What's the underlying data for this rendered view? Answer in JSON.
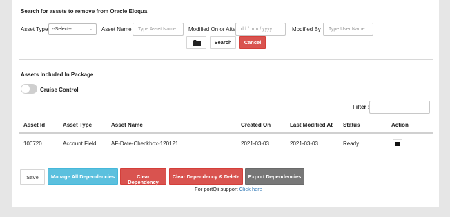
{
  "search": {
    "title": "Search for assets to remove from Oracle Eloqua",
    "asset_type_label": "Asset Type",
    "asset_type_value": "--Select--",
    "asset_name_label": "Asset Name",
    "asset_name_placeholder": "Type Asset Name",
    "modified_label": "Modified On or After",
    "modified_placeholder": "dd / mm / yyyy",
    "modified_by_label": "Modified By",
    "modified_by_placeholder": "Type User Name",
    "search_button": "Search",
    "cancel_button": "Cancel"
  },
  "package": {
    "title": "Assets Included In Package",
    "cruise_control_label": "Cruise Control",
    "cruise_control_on": false,
    "filter_label": "Filter :"
  },
  "table": {
    "columns": [
      "Asset Id",
      "Asset Type",
      "Asset Name",
      "Created On",
      "Last Modified At",
      "Status",
      "Action"
    ],
    "rows": [
      [
        "100720",
        "Account Field",
        "AF-Date-Checkbox-120121",
        "2021-03-03",
        "2021-03-03",
        "Ready"
      ]
    ]
  },
  "actions": {
    "save": "Save",
    "manage_all": "Manage All Dependencies",
    "clear_dependency": "Clear Dependency",
    "clear_and_delete": "Clear Dependency & Delete",
    "export": "Export Dependencies"
  },
  "support": {
    "text": "For portQii support",
    "link": "Click here"
  },
  "icons": {
    "folder": "folder-icon",
    "dropdown": "chevron-down-icon",
    "action_menu": "hamburger-menu-icon"
  },
  "colors": {
    "danger": "#d9534f",
    "info": "#5bc0de",
    "neutral": "#777777",
    "link": "#337ab7"
  }
}
